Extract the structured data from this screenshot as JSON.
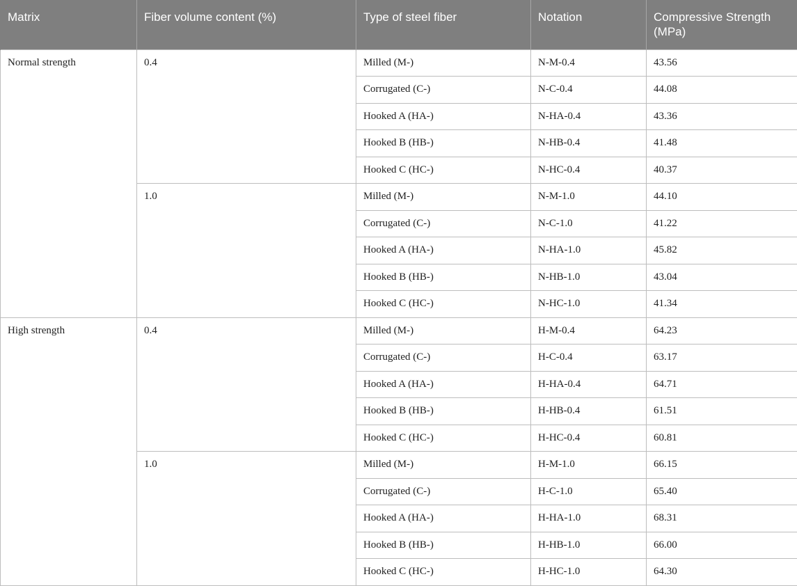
{
  "headers": [
    "Matrix",
    "Fiber volume content (%)",
    "Type of steel fiber",
    "Notation",
    "Compressive Strength (MPa)"
  ],
  "groups": [
    {
      "matrix": "Normal strength",
      "blocks": [
        {
          "volume": "0.4",
          "rows": [
            {
              "type": "Milled (M-)",
              "notation": "N-M-0.4",
              "strength": "43.56"
            },
            {
              "type": "Corrugated (C-)",
              "notation": "N-C-0.4",
              "strength": "44.08"
            },
            {
              "type": "Hooked A (HA-)",
              "notation": "N-HA-0.4",
              "strength": "43.36"
            },
            {
              "type": "Hooked B (HB-)",
              "notation": "N-HB-0.4",
              "strength": "41.48"
            },
            {
              "type": "Hooked C (HC-)",
              "notation": "N-HC-0.4",
              "strength": "40.37"
            }
          ]
        },
        {
          "volume": "1.0",
          "rows": [
            {
              "type": "Milled (M-)",
              "notation": "N-M-1.0",
              "strength": "44.10"
            },
            {
              "type": "Corrugated (C-)",
              "notation": "N-C-1.0",
              "strength": "41.22"
            },
            {
              "type": "Hooked A (HA-)",
              "notation": "N-HA-1.0",
              "strength": "45.82"
            },
            {
              "type": "Hooked B (HB-)",
              "notation": "N-HB-1.0",
              "strength": "43.04"
            },
            {
              "type": "Hooked C (HC-)",
              "notation": "N-HC-1.0",
              "strength": "41.34"
            }
          ]
        }
      ]
    },
    {
      "matrix": "High strength",
      "blocks": [
        {
          "volume": "0.4",
          "rows": [
            {
              "type": "Milled (M-)",
              "notation": "H-M-0.4",
              "strength": "64.23"
            },
            {
              "type": "Corrugated (C-)",
              "notation": "H-C-0.4",
              "strength": "63.17"
            },
            {
              "type": "Hooked A (HA-)",
              "notation": "H-HA-0.4",
              "strength": "64.71"
            },
            {
              "type": "Hooked B (HB-)",
              "notation": "H-HB-0.4",
              "strength": "61.51"
            },
            {
              "type": "Hooked C (HC-)",
              "notation": "H-HC-0.4",
              "strength": "60.81"
            }
          ]
        },
        {
          "volume": "1.0",
          "rows": [
            {
              "type": "Milled (M-)",
              "notation": "H-M-1.0",
              "strength": "66.15"
            },
            {
              "type": "Corrugated (C-)",
              "notation": "H-C-1.0",
              "strength": "65.40"
            },
            {
              "type": "Hooked A (HA-)",
              "notation": "H-HA-1.0",
              "strength": "68.31"
            },
            {
              "type": "Hooked B (HB-)",
              "notation": "H-HB-1.0",
              "strength": "66.00"
            },
            {
              "type": "Hooked C (HC-)",
              "notation": "H-HC-1.0",
              "strength": "64.30"
            }
          ]
        }
      ]
    }
  ]
}
